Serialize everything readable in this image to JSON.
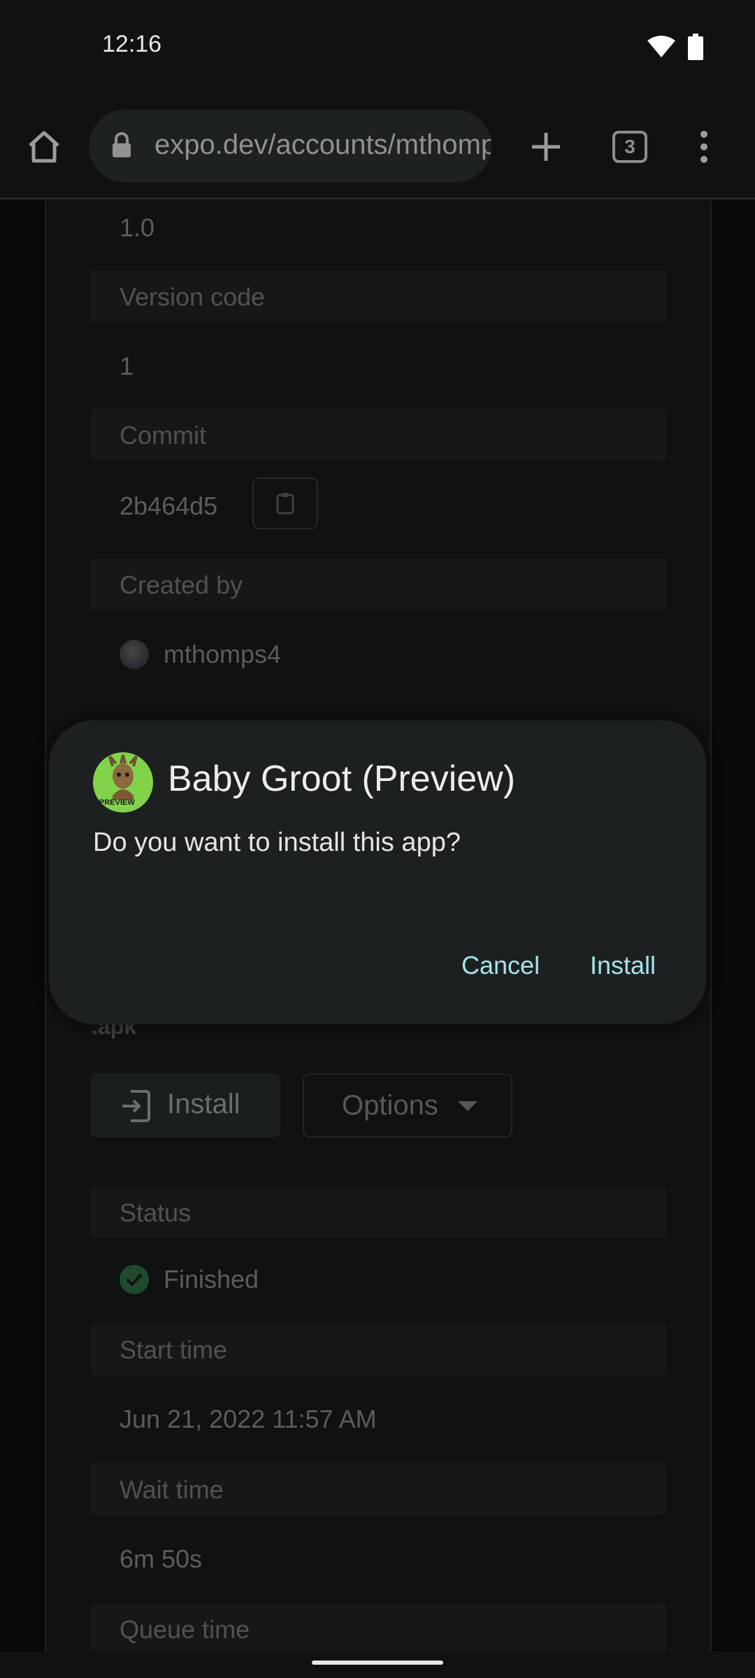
{
  "status_bar": {
    "time": "12:16"
  },
  "browser": {
    "url": "expo.dev/accounts/mthompson",
    "tab_count": "3"
  },
  "build_details": {
    "version_value": "1.0",
    "version_code_label": "Version code",
    "version_code_value": "1",
    "commit_label": "Commit",
    "commit_value": "2b464d5",
    "created_by_label": "Created by",
    "created_by_value": "mthomps4",
    "artifact_type": ".apk",
    "install_label": "Install",
    "options_label": "Options",
    "status_label": "Status",
    "status_value": "Finished",
    "start_time_label": "Start time",
    "start_time_value": "Jun 21, 2022 11:57 AM",
    "wait_time_label": "Wait time",
    "wait_time_value": "6m 50s",
    "queue_time_label": "Queue time"
  },
  "dialog": {
    "app_name": "Baby Groot (Preview)",
    "app_icon_badge": "PREVIEW",
    "message": "Do you want to install this app?",
    "cancel_label": "Cancel",
    "install_label": "Install"
  },
  "colors": {
    "dialog_bg": "#1d2021",
    "accent": "#a6e4e9",
    "app_icon_bg": "#82d34a",
    "success": "#2e7d45"
  }
}
